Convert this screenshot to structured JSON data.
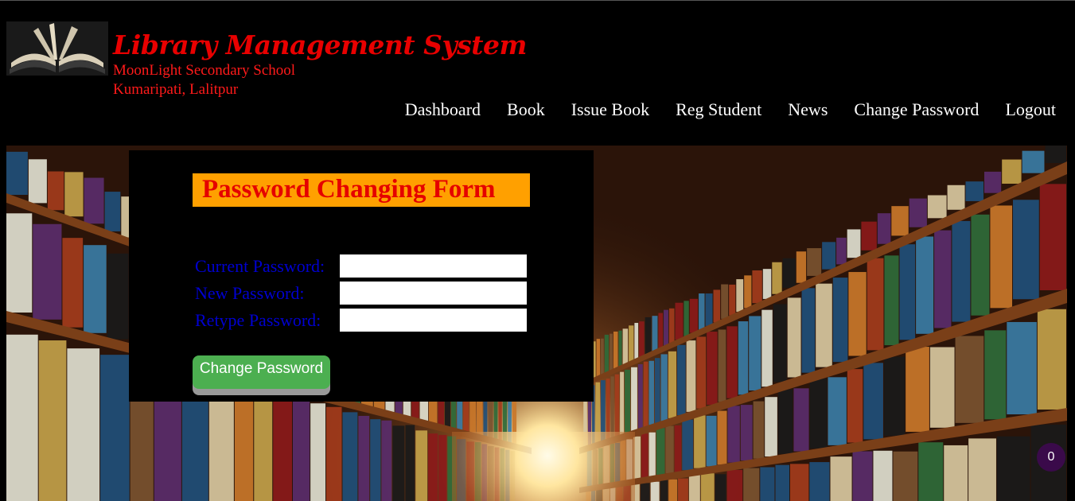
{
  "header": {
    "title": "Library Management System",
    "school": "MoonLight Secondary School",
    "address": "Kumaripati, Lalitpur"
  },
  "nav": {
    "items": [
      "Dashboard",
      "Book",
      "Issue Book",
      "Reg Student",
      "News",
      "Change Password",
      "Logout"
    ]
  },
  "form": {
    "title": "Password Changing Form",
    "current_label": "Current Password:",
    "new_label": "New Password:",
    "retype_label": "Retype Password:",
    "current_value": "",
    "new_value": "",
    "retype_value": "",
    "submit_label": "Change Password"
  },
  "badge": {
    "count": "0"
  },
  "colors": {
    "title_red": "#e80000",
    "form_title_bg": "#ffa000",
    "label_blue": "#0000d0",
    "button_green": "#4caf50"
  }
}
